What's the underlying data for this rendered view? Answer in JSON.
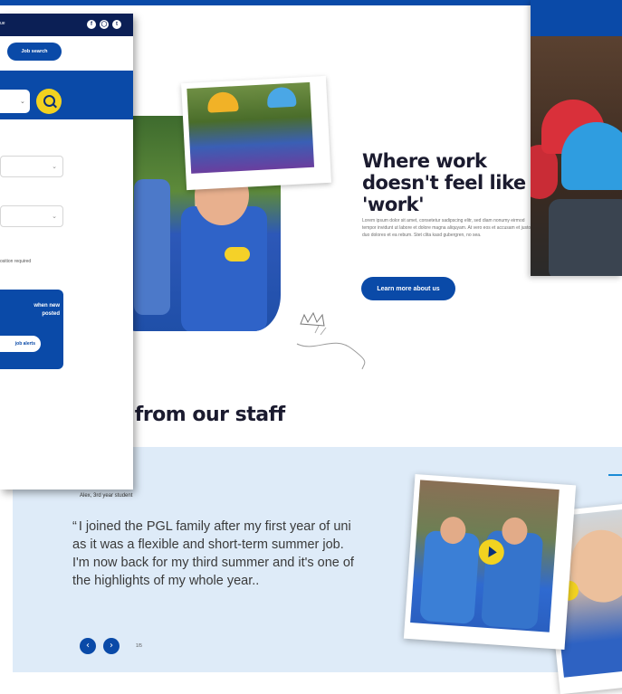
{
  "main": {
    "hero": {
      "heading": "Where work doesn't feel like 'work'",
      "body": "Lorem ipsum dolor sit amet, consetetur sadipscing elitr, sed diam nonumy eirmod tempor invidunt ut labore et dolore magna aliquyam. At vero eos et accusam et justo duo dolores et ea rebum. Stet clita kasd gubergren, no sea.",
      "cta_label": "Learn more about us"
    },
    "staff": {
      "heading_visible": "s from our staff",
      "quote_author": "Alex, 3rd year student",
      "quote_mark": "“",
      "quote_text": "I joined the PGL family after my first year of uni as it was a flexible and short-term summer job. I'm now back for my third summer and it's one of the highlights of my whole year..",
      "prev_icon": "‹",
      "next_icon": "›",
      "slide_count": "1/5"
    }
  },
  "overlay": {
    "top_link": "ue",
    "social_icons": [
      "facebook-icon",
      "instagram-icon",
      "twitter-icon"
    ],
    "job_search_label": "Job search",
    "required_note": "osition required",
    "alert_text": "when new\nposted",
    "alert_button": "job alerts"
  },
  "colors": {
    "brand_blue": "#0a4aa8",
    "dark_navy": "#0b1f55",
    "accent_yellow": "#f2d220",
    "light_band": "#deebf8"
  }
}
